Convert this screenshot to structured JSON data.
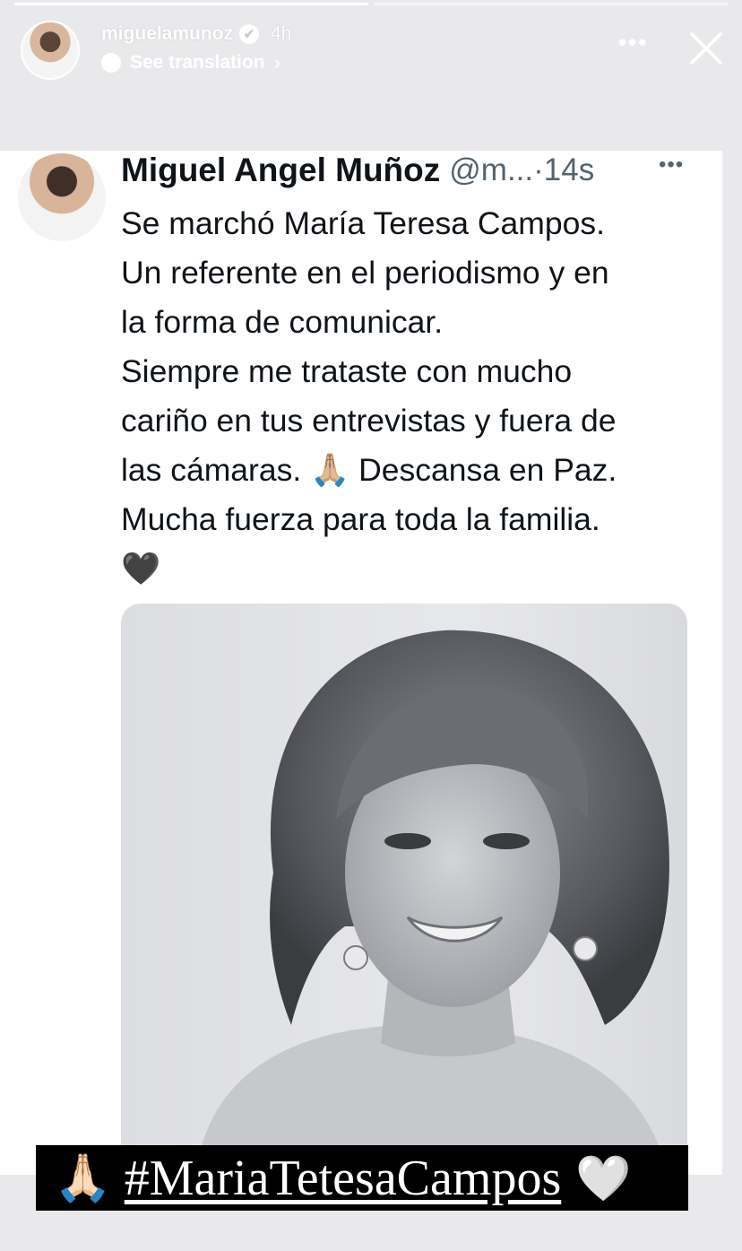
{
  "story": {
    "progress": [
      1,
      0
    ],
    "username": "miguelamunoz",
    "time_ago": "4h",
    "see_translation_label": "See translation",
    "more_icon": "ellipsis-icon",
    "close_icon": "close-icon"
  },
  "tweet": {
    "display_name": "Miguel Angel Muñoz",
    "handle": "@m...",
    "separator": "·",
    "time": "14s",
    "lines": [
      "Se marchó María Teresa Campos.",
      "Un referente en el periodismo y en",
      "la forma de comunicar.",
      "Siempre me trataste con mucho",
      "cariño en tus entrevistas y fuera de",
      "las cámaras. 🙏🏼 Descansa en Paz.",
      "Mucha fuerza para toda la familia.",
      "🖤"
    ],
    "more_icon": "ellipsis-icon"
  },
  "sticker": {
    "emoji": "🙏🏻",
    "hashtag": "#MariaTetesaCampos",
    "heart": "🤍"
  }
}
